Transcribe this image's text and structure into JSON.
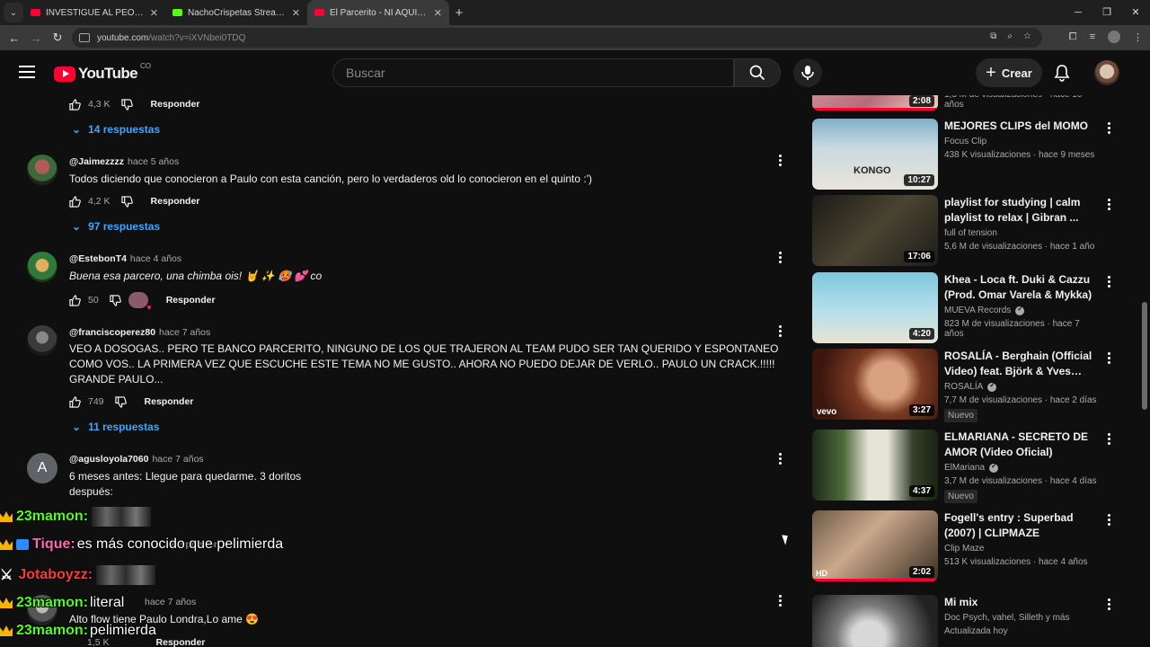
{
  "browser": {
    "tabs": [
      {
        "title": "INVESTIGUÉ AL PEOR ASESINO",
        "favicon": "youtube"
      },
      {
        "title": "NachoCrispetas Stream - Watc",
        "favicon": "kick"
      },
      {
        "title": "El Parcerito - NI AQUI NI DE AL",
        "favicon": "youtube",
        "active": true
      }
    ],
    "new_tab": "+",
    "url_host": "youtube.com",
    "url_path": "/watch?v=iXVNbei0TDQ"
  },
  "header": {
    "logo_text": "YouTube",
    "country_code": "CO",
    "search_placeholder": "Buscar",
    "create_label": "Crear"
  },
  "comments": [
    {
      "likes": "4,3 K",
      "reply_label": "Responder",
      "replies": "14 respuestas"
    },
    {
      "user": "@Jaimezzzz",
      "time": "hace 5 años",
      "text": "Todos diciendo que conocieron a Paulo con esta canción, pero lo verdaderos old lo conocieron en el quinto :')",
      "likes": "4,2 K",
      "reply_label": "Responder",
      "replies": "97 respuestas"
    },
    {
      "user": "@EstebonT4",
      "time": "hace 4 años",
      "text": "Buena esa parcero, una chimba ois! 🤘 ✨ 🥵 💕 co",
      "likes": "50",
      "reply_label": "Responder"
    },
    {
      "user": "@franciscoperez80",
      "time": "hace 7 años",
      "text": "VEO A DOSOGAS.. PERO TE BANCO PARCERITO, NINGUNO DE LOS QUE TRAJERON AL TEAM PUDO SER TAN QUERIDO Y ESPONTANEO COMO VOS.. LA PRIMERA VEZ QUE ESCUCHE ESTE TEMA NO ME GUSTO.. AHORA NO PUEDO DEJAR DE VERLO.. PAULO UN CRACK.!!!!! GRANDE PAULO...",
      "likes": "749",
      "reply_label": "Responder",
      "replies": "11 respuestas"
    },
    {
      "user": "@agusloyola7060",
      "time": "hace 7 años",
      "avatar_letter": "A",
      "text": "6 meses antes: Llegue para quedarme. 3 doritos después:",
      "reply_label": "Responder"
    },
    {
      "time": "hace 7 años",
      "text": "Alto flow tiene Paulo Londra,Lo ame 😍",
      "likes": "1,5 K",
      "reply_label": "Responder"
    }
  ],
  "sidebar": [
    {
      "duration": "2:08",
      "meta": "1,3 M de visualizaciones · hace 10 años",
      "progress": 0.99
    },
    {
      "title": "MEJORES CLIPS del MOMO",
      "channel": "Focus Clip",
      "meta": "438 K visualizaciones · hace 9 meses",
      "duration": "10:27",
      "thumb_text": "KONGO"
    },
    {
      "title": "playlist for studying | calm playlist to relax | Gibran ...",
      "channel": "full of tension",
      "meta": "5,6 M de visualizaciones · hace 1 año",
      "duration": "17:06"
    },
    {
      "title": "Khea - Loca ft. Duki & Cazzu (Prod. Omar Varela & Mykka)",
      "channel": "MUEVA Records",
      "verified": true,
      "meta": "823 M de visualizaciones · hace 7 años",
      "duration": "4:20"
    },
    {
      "title": "ROSALÍA - Berghain (Official Video) feat. Björk & Yves Tumor",
      "channel": "ROSALÍA",
      "verified": true,
      "meta": "7,7 M de visualizaciones · hace 2 días",
      "duration": "3:27",
      "badge": "Nuevo",
      "overlay": "vevo"
    },
    {
      "title": "ELMARIANA - SECRETO DE AMOR (Video Oficial)",
      "channel": "ElMariana",
      "verified": true,
      "meta": "3,7 M de visualizaciones · hace 4 días",
      "duration": "4:37",
      "badge": "Nuevo"
    },
    {
      "title": "Fogell's entry : Superbad (2007) | CLIPMAZE",
      "channel": "Clip Maze",
      "meta": "513 K visualizaciones · hace 4 años",
      "duration": "2:02",
      "hd": "HD",
      "progress": 0.99
    },
    {
      "title": "Mi mix",
      "channel": "Doc Psych, vahel, Silleth y más",
      "meta": "Actualizada hoy"
    }
  ],
  "chat": [
    {
      "name": "23mamon:",
      "color": "#53fc18",
      "message": "",
      "emote": true
    },
    {
      "name": "Tique:",
      "color": "#ff69b4",
      "message": "es más conocido que pelimierda"
    },
    {
      "name": "Jotaboyzz:",
      "color": "#ff3b3b",
      "message": "",
      "emote": true
    },
    {
      "name": "23mamon:",
      "color": "#53fc18",
      "message": "literal"
    },
    {
      "name": "23mamon:",
      "color": "#53fc18",
      "message": "pelimierda"
    }
  ],
  "colors": {
    "accent_red": "#ff0033",
    "link_blue": "#3ea6ff",
    "background": "#0f0f0f"
  }
}
